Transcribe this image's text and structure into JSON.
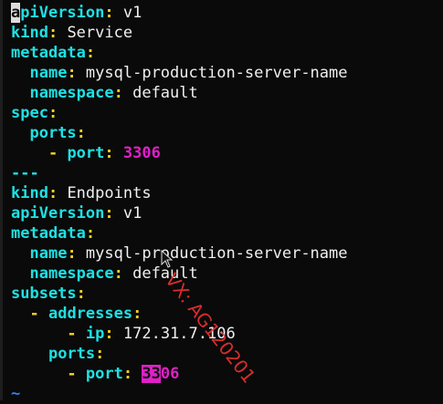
{
  "editor": {
    "lines": [
      {
        "type": "kv",
        "indent": "",
        "dash": "",
        "key": "apiVersion",
        "value": " v1",
        "cursor": "a"
      },
      {
        "type": "kv",
        "indent": "",
        "dash": "",
        "key": "kind",
        "value": " Service"
      },
      {
        "type": "kv",
        "indent": "",
        "dash": "",
        "key": "metadata",
        "value": ""
      },
      {
        "type": "kv",
        "indent": "  ",
        "dash": "",
        "key": "name",
        "value": " mysql-production-server-name"
      },
      {
        "type": "kv",
        "indent": "  ",
        "dash": "",
        "key": "namespace",
        "value": " default"
      },
      {
        "type": "kv",
        "indent": "",
        "dash": "",
        "key": "spec",
        "value": ""
      },
      {
        "type": "kv",
        "indent": "  ",
        "dash": "",
        "key": "ports",
        "value": ""
      },
      {
        "type": "kvnum",
        "indent": "    ",
        "dash": "- ",
        "key": "port",
        "value": "3306"
      },
      {
        "type": "sep",
        "text": "---"
      },
      {
        "type": "kv",
        "indent": "",
        "dash": "",
        "key": "kind",
        "value": " Endpoints"
      },
      {
        "type": "kv",
        "indent": "",
        "dash": "",
        "key": "apiVersion",
        "value": " v1"
      },
      {
        "type": "kv",
        "indent": "",
        "dash": "",
        "key": "metadata",
        "value": ""
      },
      {
        "type": "kv",
        "indent": "  ",
        "dash": "",
        "key": "name",
        "value": " mysql-production-server-name"
      },
      {
        "type": "kv",
        "indent": "  ",
        "dash": "",
        "key": "namespace",
        "value": " default"
      },
      {
        "type": "kv",
        "indent": "",
        "dash": "",
        "key": "subsets",
        "value": ""
      },
      {
        "type": "kv",
        "indent": "  ",
        "dash": "- ",
        "key": "addresses",
        "value": ""
      },
      {
        "type": "kv",
        "indent": "      ",
        "dash": "- ",
        "key": "ip",
        "value": " 172.31.7.106"
      },
      {
        "type": "kv",
        "indent": "    ",
        "dash": "",
        "key": "ports",
        "value": ""
      },
      {
        "type": "kvnum",
        "indent": "      ",
        "dash": "- ",
        "key": "port",
        "value": "3306",
        "highlight": "33"
      },
      {
        "type": "tilde",
        "text": "~"
      }
    ]
  },
  "watermark": "VX: AG120201",
  "colors": {
    "background": "#0a0a0a",
    "key": "#1ee0e3",
    "colon": "#f3d21f",
    "number": "#e020c8",
    "tilde": "#3a7cf5",
    "watermark": "#ff3333"
  }
}
